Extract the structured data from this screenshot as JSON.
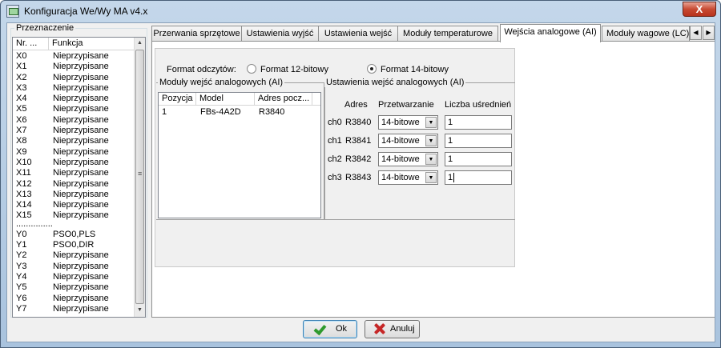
{
  "window": {
    "title": "Konfiguracja We/Wy MA v4.x",
    "close_glyph": "X"
  },
  "left_panel": {
    "group_label": "Przeznaczenie",
    "columns": [
      "Nr. ...",
      "Funkcja"
    ],
    "rows_x": [
      [
        "X0",
        "Nieprzypisane"
      ],
      [
        "X1",
        "Nieprzypisane"
      ],
      [
        "X2",
        "Nieprzypisane"
      ],
      [
        "X3",
        "Nieprzypisane"
      ],
      [
        "X4",
        "Nieprzypisane"
      ],
      [
        "X5",
        "Nieprzypisane"
      ],
      [
        "X6",
        "Nieprzypisane"
      ],
      [
        "X7",
        "Nieprzypisane"
      ],
      [
        "X8",
        "Nieprzypisane"
      ],
      [
        "X9",
        "Nieprzypisane"
      ],
      [
        "X10",
        "Nieprzypisane"
      ],
      [
        "X11",
        "Nieprzypisane"
      ],
      [
        "X12",
        "Nieprzypisane"
      ],
      [
        "X13",
        "Nieprzypisane"
      ],
      [
        "X14",
        "Nieprzypisane"
      ],
      [
        "X15",
        "Nieprzypisane"
      ]
    ],
    "separator": "...............",
    "rows_y": [
      [
        "Y0",
        "PSO0,PLS"
      ],
      [
        "Y1",
        "PSO0,DIR"
      ],
      [
        "Y2",
        "Nieprzypisane"
      ],
      [
        "Y3",
        "Nieprzypisane"
      ],
      [
        "Y4",
        "Nieprzypisane"
      ],
      [
        "Y5",
        "Nieprzypisane"
      ],
      [
        "Y6",
        "Nieprzypisane"
      ],
      [
        "Y7",
        "Nieprzypisane"
      ]
    ]
  },
  "tabs": [
    "Przerwania sprzętowe",
    "Ustawienia wyjść",
    "Ustawienia wejść",
    "Moduły temperaturowe",
    "Wejścia analogowe (AI)",
    "Moduły wagowe (LC)"
  ],
  "active_tab": 4,
  "format": {
    "label": "Format odczytów:",
    "option_12": "Format 12-bitowy",
    "option_14": "Format 14-bitowy",
    "selected": "14"
  },
  "modules": {
    "group_label": "Moduły wejść analogowych (AI)",
    "columns": [
      "Pozycja",
      "Model",
      "Adres pocz..."
    ],
    "rows": [
      [
        "1",
        "FBs-4A2D",
        "R3840"
      ]
    ]
  },
  "ai_settings": {
    "group_label": "Ustawienia wejść analogowych (AI)",
    "headers": {
      "address": "Adres",
      "processing": "Przetwarzanie",
      "averaging": "Liczba uśrednień"
    },
    "channels": [
      {
        "ch": "ch0",
        "address": "R3840",
        "processing": "14-bitowe",
        "averaging": "1"
      },
      {
        "ch": "ch1",
        "address": "R3841",
        "processing": "14-bitowe",
        "averaging": "1"
      },
      {
        "ch": "ch2",
        "address": "R3842",
        "processing": "14-bitowe",
        "averaging": "1"
      },
      {
        "ch": "ch3",
        "address": "R3843",
        "processing": "14-bitowe",
        "averaging": "1"
      }
    ]
  },
  "buttons": {
    "ok": "Ok",
    "cancel": "Anuluj"
  },
  "icons": [
    "app-icon",
    "close-icon",
    "check-icon",
    "x-icon",
    "chevron-down-icon",
    "arrow-left-icon",
    "arrow-right-icon"
  ]
}
